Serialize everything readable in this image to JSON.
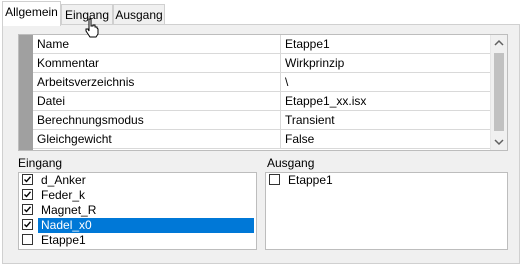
{
  "tabs": [
    {
      "label": "Allgemein",
      "active": true
    },
    {
      "label": "Eingang",
      "active": false
    },
    {
      "label": "Ausgang",
      "active": false
    }
  ],
  "properties": {
    "rows": [
      {
        "name": "Name",
        "value": "Etappe1"
      },
      {
        "name": "Kommentar",
        "value": "Wirkprinzip"
      },
      {
        "name": "Arbeitsverzeichnis",
        "value": "\\"
      },
      {
        "name": "Datei",
        "value": "Etappe1_xx.isx"
      },
      {
        "name": "Berechnungsmodus",
        "value": "Transient"
      },
      {
        "name": "Gleichgewicht",
        "value": "False"
      }
    ]
  },
  "eingang": {
    "label": "Eingang",
    "items": [
      {
        "label": "d_Anker",
        "checked": true,
        "selected": false
      },
      {
        "label": "Feder_k",
        "checked": true,
        "selected": false
      },
      {
        "label": "Magnet_R",
        "checked": true,
        "selected": false
      },
      {
        "label": "Nadel_x0",
        "checked": true,
        "selected": true
      },
      {
        "label": "Etappe1",
        "checked": false,
        "selected": false
      }
    ]
  },
  "ausgang": {
    "label": "Ausgang",
    "items": [
      {
        "label": "Etappe1",
        "checked": false,
        "selected": false
      }
    ]
  },
  "colors": {
    "selection": "#0078d7",
    "panel": "#f0f0f0",
    "gutter": "#a0a0a0"
  }
}
